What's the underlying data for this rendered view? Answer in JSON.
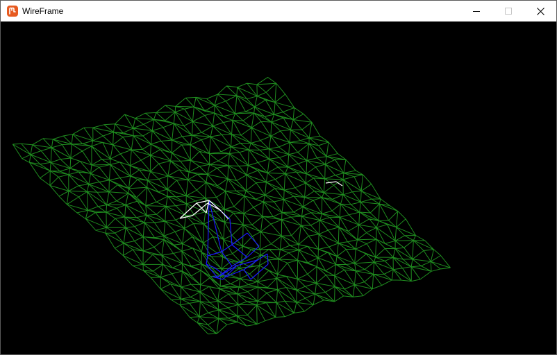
{
  "window": {
    "title": "WireFrame"
  },
  "titlebar": {
    "icon": "monogame-logo-icon",
    "buttons": [
      {
        "name": "minimize-button",
        "icon": "minimize-icon"
      },
      {
        "name": "maximize-button",
        "icon": "maximize-icon",
        "disabled": true
      },
      {
        "name": "close-button",
        "icon": "close-icon"
      }
    ]
  },
  "scene": {
    "background": "#000000",
    "terrain_color": "#1f8c1f",
    "highlight_color": "#ffffff",
    "selection_color": "#1a1aff",
    "grid_rows": 21,
    "grid_cols": 25
  },
  "brand": {
    "icon_color": "#e75a20"
  }
}
